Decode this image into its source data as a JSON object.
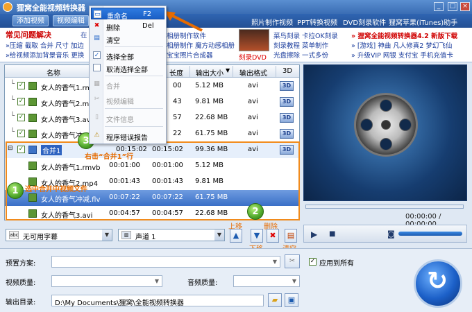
{
  "window": {
    "title": "狸窝全能视频转换器"
  },
  "topbar": {
    "tabs": [
      {
        "label": "添加视频"
      },
      {
        "label": "视频编辑"
      }
    ],
    "links": [
      {
        "label": "照片制作视频"
      },
      {
        "label": "PPT转换视频"
      },
      {
        "label": "DVD刻录软件"
      },
      {
        "label": "狸窝苹果(iTunes)助手"
      }
    ]
  },
  "faq": {
    "title": "常见问题解决",
    "cut_title": "在",
    "line1": "»压缩 截取 合并 尺寸 加边",
    "line2": "»给视频添加背景音乐 更换"
  },
  "promo": {
    "links": [
      {
        "label": "相册制作软件"
      },
      {
        "label": "相册制作  魔方动感相册"
      },
      {
        "label": "宝宝照片合成器"
      }
    ],
    "dvd_label": "刻录DVD",
    "col2": [
      "菜鸟刻录 卡拉OK刻录",
      "刻录教程 菜单制作",
      "光盘擦除 一式多份"
    ],
    "col3": [
      "» 狸窝全能视频转换器4.2 新版下载",
      "» [游戏] 神曲 凡人修真2 梦幻飞仙",
      "» 升级VIP 网银 支付宝 手机充值卡"
    ]
  },
  "table": {
    "headers": {
      "name": "名称",
      "duration": "长度",
      "size": "输出大小",
      "sort": "▼",
      "format": "输出格式",
      "threed": "3D"
    },
    "rows": [
      {
        "name": "女人的香气1.rm",
        "start": "",
        "duration": "00",
        "size": "5.12 MB",
        "format": "avi"
      },
      {
        "name": "女人的香气2.mp",
        "start": "",
        "duration": "43",
        "size": "9.81 MB",
        "format": "avi"
      },
      {
        "name": "女人的香气3.av",
        "start": "",
        "duration": "57",
        "size": "22.68 MB",
        "format": "avi"
      },
      {
        "name": "女人的香气冲",
        "start": "",
        "duration": "22",
        "size": "61.75 MB",
        "format": "avi"
      },
      {
        "name": "合并1",
        "start": "00:15:02",
        "duration": "00:15:02",
        "size": "99.36 MB",
        "format": "avi"
      },
      {
        "name": "女人的香气1.rmvb",
        "start": "00:01:00",
        "duration": "00:01:00",
        "size": "5.12 MB",
        "format": ""
      },
      {
        "name": "女人的香气2.mp4",
        "start": "00:01:43",
        "duration": "00:01:43",
        "size": "9.81 MB",
        "format": ""
      },
      {
        "name": "女人的香气冲减.flv",
        "start": "00:07:22",
        "duration": "00:07:22",
        "size": "61.75 MB",
        "format": ""
      },
      {
        "name": "女人的香气3.avi",
        "start": "00:04:57",
        "duration": "00:04:57",
        "size": "22.68 MB",
        "format": ""
      }
    ]
  },
  "context_menu": {
    "items": [
      {
        "label": "重命名",
        "key": "F2"
      },
      {
        "label": "删除",
        "key": "Del"
      },
      {
        "label": "清空",
        "key": ""
      },
      {
        "label": "选择全部",
        "key": ""
      },
      {
        "label": "取消选择全部",
        "key": ""
      },
      {
        "label": "合并",
        "key": ""
      },
      {
        "label": "视频编辑",
        "key": ""
      },
      {
        "label": "文件信息",
        "key": ""
      },
      {
        "label": "程序错误报告",
        "key": ""
      }
    ]
  },
  "annotations": {
    "step1_num": "1",
    "step1": "选中合并中视频文件",
    "step2_num": "2",
    "step3_num": "3",
    "step3": "右击“合并1”行"
  },
  "list_tools": {
    "subtitle": "无可用字幕",
    "subtitle_icon": "abc",
    "audio": "声道 1",
    "up": "上移",
    "down": "下移",
    "delete": "删除",
    "clear": "清空"
  },
  "player": {
    "time": "00:00:00 / 00:00:00"
  },
  "settings": {
    "preset_label": "预置方案:",
    "apply_all": "应用到所有",
    "video_quality_label": "视频质量:",
    "audio_quality_label": "音频质量:",
    "output_label": "输出目录:",
    "output_path": "D:\\My Documents\\狸窝\\全能视频转换器"
  },
  "colors": {
    "accent": "#3a6fc7",
    "annotation": "#e66b00",
    "link": "#1a3c9c",
    "badge_red": "#d00000"
  }
}
